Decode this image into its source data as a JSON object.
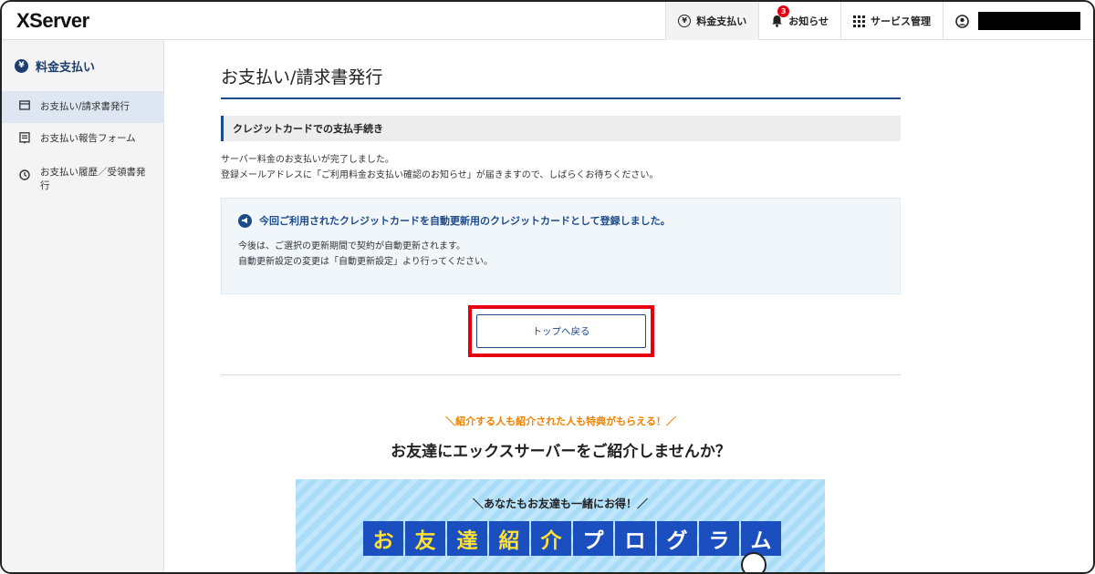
{
  "header": {
    "logo": "XServer",
    "nav": [
      {
        "label": "料金支払い",
        "icon": "yen-circle-icon"
      },
      {
        "label": "お知らせ",
        "icon": "bell-icon",
        "badge": "3"
      },
      {
        "label": "サービス管理",
        "icon": "grid-icon"
      }
    ],
    "user_icon": "user-circle-icon"
  },
  "sidebar": {
    "title": "料金支払い",
    "title_icon": "yen-icon",
    "items": [
      {
        "label": "お支払い/請求書発行",
        "icon": "card-icon",
        "active": true
      },
      {
        "label": "お支払い報告フォーム",
        "icon": "form-icon",
        "active": false
      },
      {
        "label": "お支払い履歴／受領書発行",
        "icon": "clock-icon",
        "active": false
      }
    ]
  },
  "main": {
    "title": "お支払い/請求書発行",
    "section_heading": "クレジットカードでの支払手続き",
    "message_line1": "サーバー料金のお支払いが完了しました。",
    "message_line2": "登録メールアドレスに「ご利用料金お支払い確認のお知らせ」が届きますので、しばらくお待ちください。",
    "info": {
      "title": "今回ご利用されたクレジットカードを自動更新用のクレジットカードとして登録しました。",
      "line1": "今後は、ご選択の更新期間で契約が自動更新されます。",
      "line2": "自動更新設定の変更は「自動更新設定」より行ってください。"
    },
    "top_button": "トップへ戻る",
    "promo": {
      "subtitle": "＼紹介する人も紹介された人も特典がもらえる！／",
      "title": "お友達にエックスサーバーをご紹介しませんか？",
      "banner_sub": "＼あなたもお友達も一緒にお得！／",
      "banner_chars": [
        "お",
        "友",
        "達",
        "紹",
        "介",
        "プ",
        "ロ",
        "グ",
        "ラ",
        "ム"
      ]
    }
  },
  "colors": {
    "accent": "#1c4a8a",
    "highlight": "#e60012",
    "promo_orange": "#f08200",
    "banner_blue": "#1b4fbf"
  }
}
